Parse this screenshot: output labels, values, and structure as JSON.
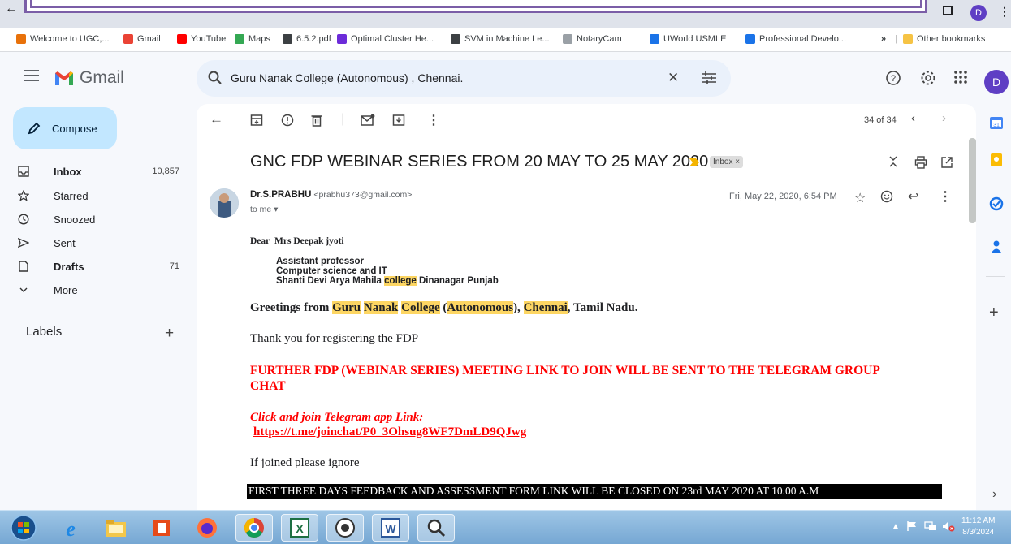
{
  "browser": {
    "avatar_letter": "D",
    "bookmarks": [
      {
        "label": "Welcome to UGC,...",
        "color": "#e8710a"
      },
      {
        "label": "Gmail",
        "color": "#ea4335"
      },
      {
        "label": "YouTube",
        "color": "#ff0000"
      },
      {
        "label": "Maps",
        "color": "#34a853"
      },
      {
        "label": "6.5.2.pdf",
        "color": "#3c4043"
      },
      {
        "label": "Optimal Cluster He...",
        "color": "#6c2bd9"
      },
      {
        "label": "SVM in Machine Le...",
        "color": "#3c4043"
      },
      {
        "label": "NotaryCam",
        "color": "#9aa0a6"
      },
      {
        "label": "UWorld USMLE",
        "color": "#1a73e8"
      },
      {
        "label": "Professional Develo...",
        "color": "#1a73e8"
      }
    ],
    "more_chevron": "»",
    "other_bookmarks": "Other bookmarks"
  },
  "header": {
    "app_name": "Gmail",
    "search_query": "Guru Nanak College (Autonomous) , Chennai.",
    "avatar_letter": "D"
  },
  "compose": {
    "label": "Compose"
  },
  "nav": [
    {
      "label": "Inbox",
      "count": "10,857",
      "icon": "inbox-icon",
      "bold": true
    },
    {
      "label": "Starred",
      "count": "",
      "icon": "star-icon",
      "bold": false
    },
    {
      "label": "Snoozed",
      "count": "",
      "icon": "clock-icon",
      "bold": false
    },
    {
      "label": "Sent",
      "count": "",
      "icon": "send-icon",
      "bold": false
    },
    {
      "label": "Drafts",
      "count": "71",
      "icon": "draft-icon",
      "bold": true
    },
    {
      "label": "More",
      "count": "",
      "icon": "chevron-down-icon",
      "bold": false
    }
  ],
  "labels": {
    "title": "Labels",
    "add": "+"
  },
  "email": {
    "pager": "34 of 34",
    "subject": "GNC FDP WEBINAR SERIES FROM 20 MAY TO 25 MAY 2020",
    "chip": "Inbox ×",
    "sender_name": "Dr.S.PRABHU",
    "sender_email": "<prabhu373@gmail.com>",
    "to": "to me ▾",
    "date": "Fri, May 22, 2020, 6:54 PM",
    "dear_prefix": "Dear",
    "dear_name": "Mrs Deepak jyoti",
    "addr1": "Assistant professor",
    "addr2": "Computer science and IT",
    "addr3_a": "Shanti Devi Arya Mahila ",
    "addr3_hl": "college",
    "addr3_b": " Dinanagar Punjab",
    "greet_a": "Greetings from ",
    "greet_hl1": "Guru",
    "greet_hl2": "Nanak",
    "greet_hl3": "College",
    "greet_open": " (",
    "greet_hl4": "Autonomous",
    "greet_close": "), ",
    "greet_hl5": "Chennai",
    "greet_b": ", Tamil Nadu.",
    "thanks": "Thank you for registering the FDP",
    "red1": "FURTHER FDP (WEBINAR SERIES) MEETING LINK TO JOIN WILL BE SENT TO THE TELEGRAM GROUP",
    "red2": "CHAT",
    "click_join": "Click and join Telegram app Link:",
    "link": "https://t.me/joinchat/P0_3Ohsug8WF7DmLD9QJwg",
    "ignore": "If joined please ignore",
    "black_line": "FIRST THREE DAYS FEEDBACK AND ASSESSMENT FORM LINK WILL BE CLOSED ON 23rd MAY 2020 AT 10.00 A.M"
  },
  "taskbar": {
    "time": "11:12 AM",
    "date": "8/3/2024"
  }
}
